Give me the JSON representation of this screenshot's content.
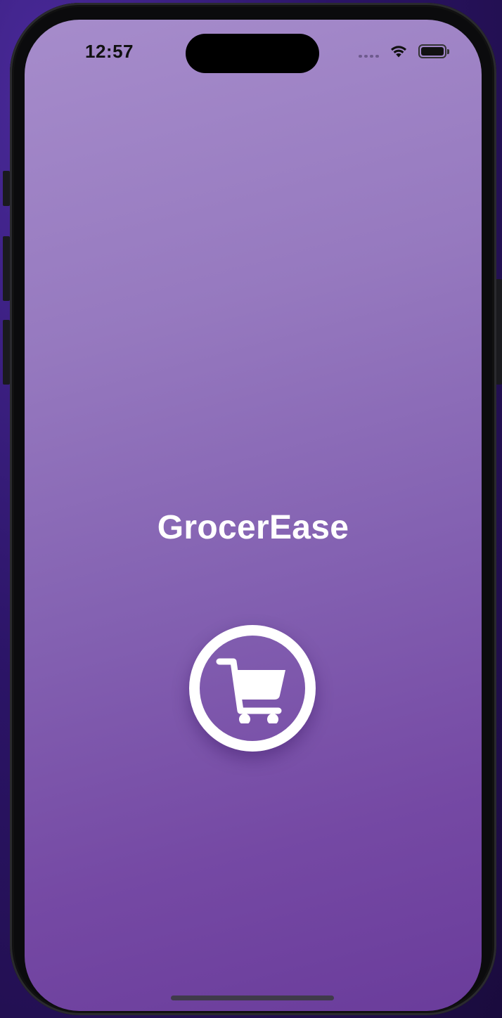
{
  "status_bar": {
    "time": "12:57",
    "icons": [
      "cellular-signal-icon",
      "wifi-icon",
      "battery-icon"
    ]
  },
  "app": {
    "title": "GrocerEase",
    "logo_icon": "shopping-cart-icon"
  },
  "colors": {
    "gradient_top": "#a68ccb",
    "gradient_bottom": "#6a3c9b",
    "title_text": "#ffffff",
    "logo": "#ffffff"
  }
}
